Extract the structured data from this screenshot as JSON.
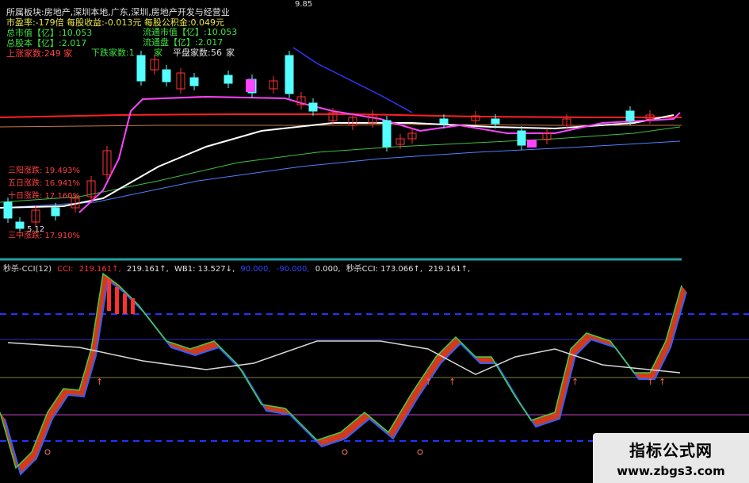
{
  "info": {
    "block": "所属板块:房地产,深圳本地,广东,深圳,房地产开发与经营业",
    "pe": "市盈率:-179倍  每股收益:-0.013元  每股公积金:0.049元",
    "total_value": "总市值【亿】:10.053",
    "float_value": "流通市值【亿】:10.053",
    "total_shares": "总股本【亿】:2.017",
    "float_shares": "流通盘【亿】:2.017",
    "up_count": "上涨家数:249 家",
    "down_count": "下跌家数:1",
    "down_unit": "家",
    "flat_count": "平盘家数:",
    "flat_value": "56",
    "flat_unit": "家",
    "high_label": "9.85",
    "low_label": "5.12",
    "left_labels": [
      "三阳涨跌: 19.493%",
      "五日涨跌: 16.941%",
      "十日涨跌: 17.160%",
      "三中涨跌: 17.910%"
    ]
  },
  "indicator": {
    "name": "秒杀-CCI(12)",
    "cci_label": "CCI:",
    "cci_value": "219.161↑,",
    "v1": "219.161↑,",
    "wb1": "WB1: 13.527↓,",
    "v2": "90.000,",
    "v3": "-90.000,",
    "v4": "0.000,",
    "cci2": "秒杀CCI: 173.066↑,",
    "v5": "219.161↑,"
  },
  "colors": {
    "up": "#ff3232",
    "down": "#54ffff",
    "ma_magenta": "#ff44ff",
    "ma_white": "#ffffff",
    "ma_red": "#ff2020",
    "ma_orange": "#c8783c",
    "ma_green": "#40c040",
    "ma_blue": "#5080ff",
    "upper_band": "#3333ff",
    "blue_dash": "#2233ff"
  },
  "watermark": {
    "title": "指标公式网",
    "url": "www.zbgs3.com"
  }
}
